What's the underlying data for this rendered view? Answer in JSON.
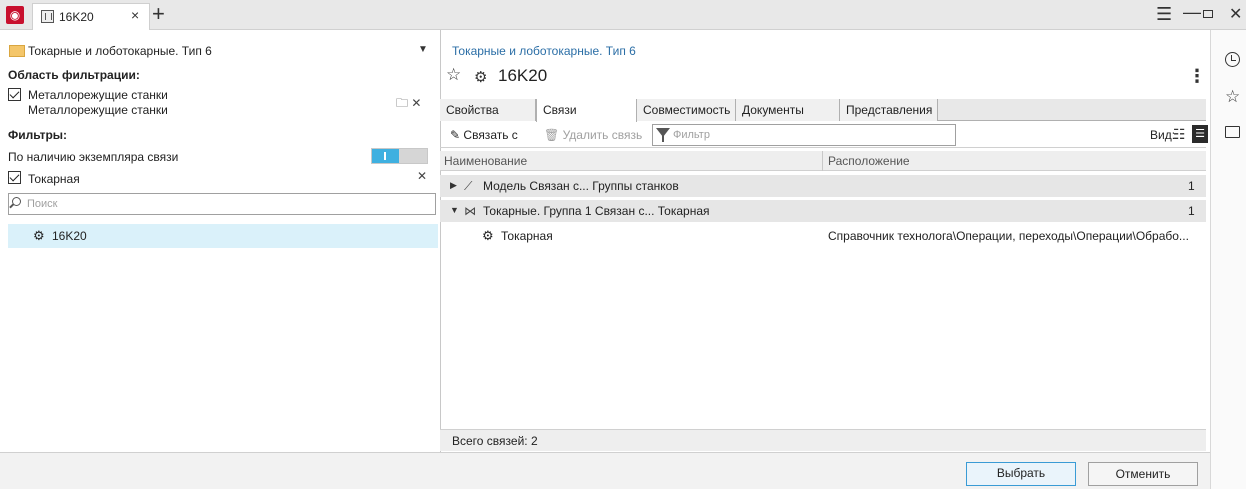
{
  "titlebar": {
    "tab_label": "16K20",
    "tab_close": "×",
    "tab_add": "+",
    "menu_glyph": "☰",
    "min_glyph": "—",
    "close_glyph": "✕"
  },
  "left": {
    "folder_label": "Токарные и лоботокарные. Тип 6",
    "area_title": "Область фильтрации:",
    "area_line1": "Металлорежущие станки",
    "area_line2": "Металлорежущие станки",
    "filters_title": "Фильтры:",
    "filter_by_link": "По наличию экземпляра связи",
    "filter_check_label": "Токарная",
    "search_placeholder": "Поиск",
    "result_label": "16K20"
  },
  "right": {
    "breadcrumb": "Токарные и лоботокарные. Тип 6",
    "title": "16K20",
    "tabs": [
      "Свойства",
      "Связи",
      "Совместимость",
      "Документы",
      "Представления"
    ],
    "active_tab": "Связи",
    "toolbar": {
      "link_label": "Связать с",
      "delete_label": "Удалить связь",
      "filter_placeholder": "Фильтр",
      "view_label": "Вид:"
    },
    "columns": {
      "name": "Наименование",
      "location": "Расположение"
    },
    "groups": [
      {
        "label": "Модель Связан с... Группы станков",
        "count": "1",
        "expanded": false
      },
      {
        "label": "Токарные. Группа 1 Связан с... Токарная",
        "count": "1",
        "expanded": true
      }
    ],
    "child": {
      "label": "Токарная",
      "location": "Справочник технолога\\Операции, переходы\\Операции\\Обрабо..."
    },
    "status": "Всего связей: 2"
  },
  "buttons": {
    "ok": "Выбрать",
    "cancel": "Отменить"
  },
  "colors": {
    "accent": "#3a9bd5",
    "selection": "#daf1fa",
    "toggle_on": "#3fb0e0",
    "link": "#2b6ea6"
  }
}
